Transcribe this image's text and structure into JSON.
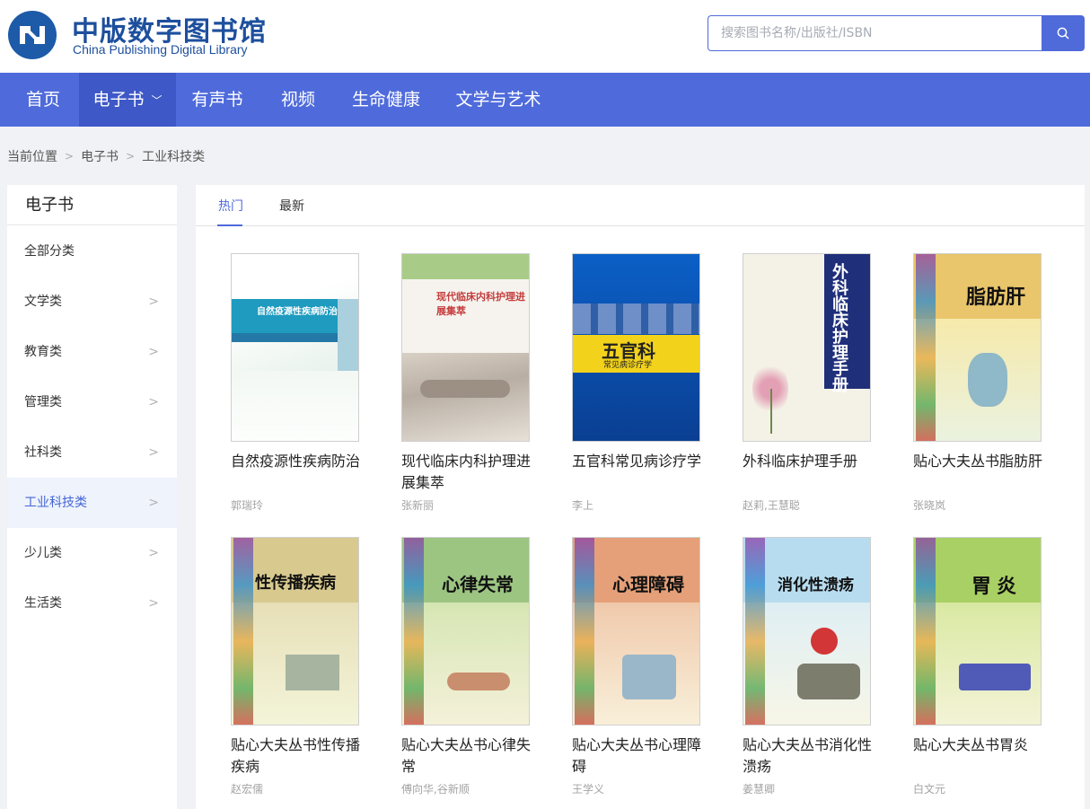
{
  "header": {
    "logo_cn": "中版数字图书馆",
    "logo_en": "China Publishing Digital Library",
    "search_placeholder": "搜索图书名称/出版社/ISBN"
  },
  "nav": {
    "items": [
      "首页",
      "电子书",
      "有声书",
      "视频",
      "生命健康",
      "文学与艺术"
    ],
    "active": "电子书"
  },
  "breadcrumb": [
    "当前位置",
    "电子书",
    "工业科技类"
  ],
  "sidebar": {
    "title": "电子书",
    "items": [
      "全部分类",
      "文学类",
      "教育类",
      "管理类",
      "社科类",
      "工业科技类",
      "少儿类",
      "生活类"
    ],
    "active": "工业科技类"
  },
  "tabs": [
    "热门",
    "最新"
  ],
  "books": [
    {
      "title": "自然疫源性疾病防治",
      "author": "郭瑞玲",
      "cover_text": "自然疫源性疾病防治"
    },
    {
      "title": "现代临床内科护理进展集萃",
      "author": "张新丽",
      "cover_text": "现代临床内科护理进展集萃"
    },
    {
      "title": "五官科常见病诊疗学",
      "author": "李上",
      "cover_text": "五官科",
      "cover_sub": "常见病诊疗学"
    },
    {
      "title": "外科临床护理手册",
      "author": "赵莉,王慧聪",
      "cover_text": "外科临床护理手册"
    },
    {
      "title": "贴心大夫丛书脂肪肝",
      "author": "张晓岚",
      "cover_text": "脂肪肝"
    },
    {
      "title": "贴心大夫丛书性传播疾病",
      "author": "赵宏儒",
      "cover_text": "性传播疾病"
    },
    {
      "title": "贴心大夫丛书心律失常",
      "author": "傅向华,谷新顺",
      "cover_text": "心律失常"
    },
    {
      "title": "贴心大夫丛书心理障碍",
      "author": "王学义",
      "cover_text": "心理障碍"
    },
    {
      "title": "贴心大夫丛书消化性溃疡",
      "author": "姜慧卿",
      "cover_text": "消化性溃疡"
    },
    {
      "title": "贴心大夫丛书胃炎",
      "author": "白文元",
      "cover_text": "胃炎"
    }
  ],
  "colors": {
    "accent": "#4f6ad9",
    "nav": "#4f6bdb",
    "nav_active": "#3e58c7"
  }
}
